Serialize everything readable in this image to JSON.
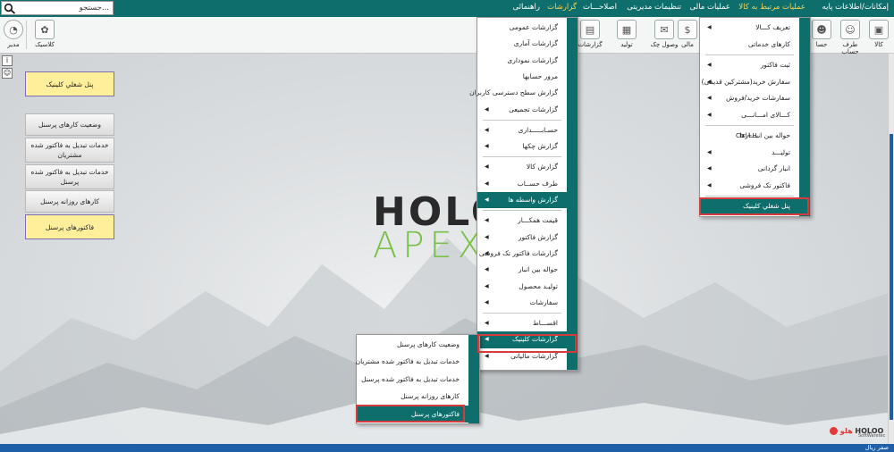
{
  "menubar": {
    "items": [
      "إمکانات/اطلاعات پایه",
      "عملیات مرتبط به کالا",
      "عملیات مالی",
      "تنظیمات مدیریتی",
      "اصلاحـــات",
      "گزارشات",
      "راهنمائی"
    ],
    "highlighted": [
      "عملیات مرتبط به کالا",
      "گزارشات"
    ]
  },
  "search": {
    "value": "جستجو..."
  },
  "toolbar": {
    "items": [
      "کالا",
      "طرف حساب",
      "حسا",
      "مالی",
      "وصول چک",
      "تولید",
      "گزارشات",
      "کلاسیک",
      "مدیر"
    ]
  },
  "left_panel": {
    "top_button": "پنل شغلي کلینیک",
    "buttons": [
      "وضعیت کارهای پرسنل",
      "خدمات تبدیل به فاکتور شده مشتریان",
      "خدمات تبدیل به فاکتور شده پرسنل",
      "کارهای روزانه پرسنل",
      "فاکتورهای پرسنل"
    ]
  },
  "logo": {
    "line1": "HOLOO",
    "line2": "APEX"
  },
  "kala_menu": {
    "items": [
      {
        "label": "تعریف کـــالا",
        "arrow": true
      },
      {
        "label": "کارهای خدماتی",
        "arrow": false
      },
      {
        "label": "ثبت فاکتور",
        "arrow": true
      },
      {
        "label": "سفارش خرید(مشترکین قدیمی)",
        "arrow": true
      },
      {
        "label": "سفارشات خرید/فروش",
        "arrow": true
      },
      {
        "label": "کـــالای امـــانـــی",
        "arrow": true
      },
      {
        "label": "حواله بین انبـــارها",
        "arrow": false,
        "shortcut": "Ctrl+H"
      },
      {
        "label": "تولیـــد",
        "arrow": true
      },
      {
        "label": "انبار گردانی",
        "arrow": true
      },
      {
        "label": "فاکتور تک فروشی",
        "arrow": true
      },
      {
        "label": "پنل شغلي کلینیک",
        "arrow": false
      }
    ]
  },
  "reports_menu": {
    "items": [
      {
        "label": "گزارشات عمومی",
        "arrow": false
      },
      {
        "label": "گزارشات آماری",
        "arrow": false
      },
      {
        "label": "گزارشات نموداری",
        "arrow": false
      },
      {
        "label": "مرور حسابها",
        "arrow": false
      },
      {
        "label": "گزارش سطح دسترسی کاربران",
        "arrow": false
      },
      {
        "label": "گزارشات تجمیعی",
        "arrow": true
      },
      {
        "label": "حسـابـــــداری",
        "arrow": true
      },
      {
        "label": "گزارش چکها",
        "arrow": true
      },
      {
        "label": "گزارش کالا",
        "arrow": true
      },
      {
        "label": "طرف حســاب",
        "arrow": true
      },
      {
        "label": "گزارش واسطه ها",
        "arrow": true
      },
      {
        "label": "قیمت همکـــار",
        "arrow": true
      },
      {
        "label": "گزارش فاکتور",
        "arrow": true
      },
      {
        "label": "گزارشات فاکتور تک فروشی",
        "arrow": true
      },
      {
        "label": "حواله بین انبار",
        "arrow": true
      },
      {
        "label": "تولیـد محصول",
        "arrow": true
      },
      {
        "label": "سفارشات",
        "arrow": true
      },
      {
        "label": "اقســـاط",
        "arrow": true
      },
      {
        "label": "گزارشات کلینیک",
        "arrow": true
      },
      {
        "label": "گزارشات مالیاتی",
        "arrow": true
      }
    ]
  },
  "clinic_submenu": {
    "items": [
      "وضعیت کارهای پرسنل",
      "خدمات تبدیل به فاکتور شده مشتریان",
      "خدمات تبدیل به فاکتور شده پرسنل",
      "کارهای روزانه پرسنل",
      "فاکتورهای پرسنل"
    ]
  },
  "brand": {
    "name": "HOLOO",
    "sub": "SoftWaretec",
    "fa": "هلو"
  },
  "statusbar": {
    "text": "صفر ریال"
  }
}
